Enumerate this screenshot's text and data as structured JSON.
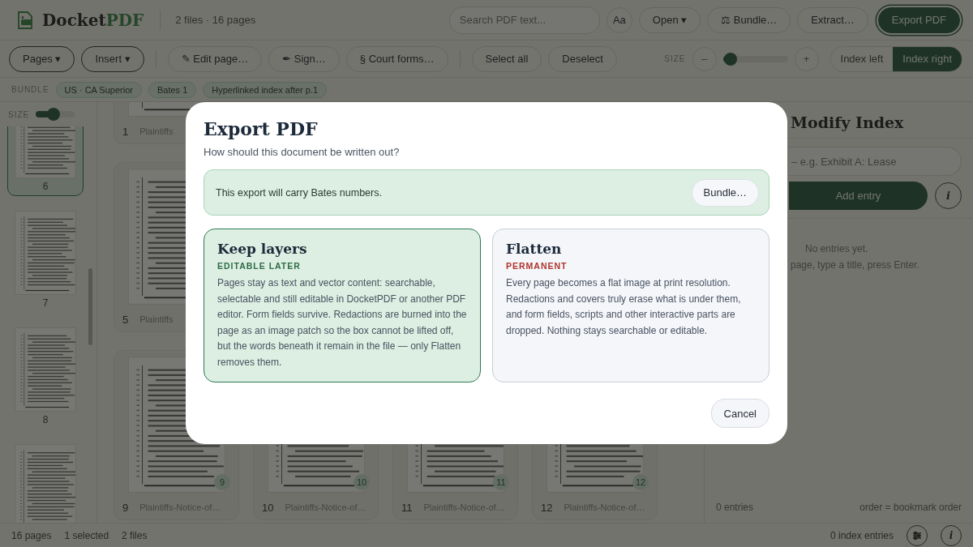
{
  "header": {
    "brand": [
      "Docket",
      "PDF"
    ],
    "summary": "2 files · 16 pages",
    "search": {
      "placeholder": "Search PDF text..."
    },
    "buttons": [
      {
        "label": "Aa",
        "kind": "round"
      },
      {
        "label": "Open ▾",
        "kind": "pill"
      },
      {
        "label": "⚖ Bundle…",
        "kind": "pill"
      },
      {
        "label": "Extract…",
        "kind": "pill"
      },
      {
        "label": "Export PDF",
        "kind": "primary"
      }
    ]
  },
  "toolbar": {
    "groups": [
      [
        {
          "label": "Pages ▾",
          "kind": "menu"
        },
        {
          "label": "Insert ▾",
          "kind": "menu"
        }
      ],
      [
        {
          "label": "✎ Edit page…",
          "kind": "pill"
        },
        {
          "label": "✒ Sign…",
          "kind": "pill"
        },
        {
          "label": "§ Court forms…",
          "kind": "pill"
        }
      ],
      [
        {
          "label": "Select all",
          "kind": "pill"
        },
        {
          "label": "Deselect",
          "kind": "pill"
        }
      ]
    ],
    "size": {
      "label": "SIZE",
      "minus": "–",
      "plus": "+",
      "level": 0.12
    },
    "layout_toggle": [
      {
        "label": "Index left",
        "selected": false
      },
      {
        "label": "Index right",
        "selected": true
      }
    ]
  },
  "bundle": {
    "label": "BUNDLE",
    "chips": [
      "US · CA Superior",
      "Bates 1",
      "Hyperlinked index after p.1"
    ]
  },
  "sidebar": {
    "size_label": "SIZE",
    "level": 0.45,
    "thumbnails": [
      {
        "label": "6",
        "selected": true
      },
      {
        "label": "7",
        "selected": false
      },
      {
        "label": "8",
        "selected": false
      },
      {
        "selected": false
      }
    ]
  },
  "pages": {
    "rows": [
      {
        "cards": [
          {
            "number": "1",
            "file": "Plaintiffs"
          }
        ]
      },
      {
        "cards": [
          {
            "number": "5",
            "file": "Plaintiffs"
          }
        ]
      },
      {
        "cards": [
          {
            "number": "9",
            "badge": "9",
            "file": "Plaintiffs-Notice-of…"
          },
          {
            "number": "10",
            "badge": "10",
            "file": "Plaintiffs-Notice-of…"
          },
          {
            "number": "11",
            "badge": "11",
            "file": "Plaintiffs-Notice-of…"
          },
          {
            "number": "12",
            "badge": "12",
            "file": "Plaintiffs-Notice-of…"
          }
        ]
      }
    ]
  },
  "index_panel": {
    "title": "Modify Index",
    "placeholder": "– e.g. Exhibit A: Lease",
    "add_button": "Add entry",
    "info_button": "i",
    "empty": [
      "No entries yet.",
      "page, type a title, press Enter."
    ],
    "count": "0 entries",
    "order": "order = bookmark order"
  },
  "status_bar": {
    "items": [
      "16 pages",
      "1 selected",
      "2 files"
    ],
    "index_count": "0 index entries",
    "info_button": "i"
  },
  "dialog": {
    "title": "Export PDF",
    "subtitle": "How should this document be written out?",
    "notice": {
      "text": "This export will carry Bates numbers.",
      "button": "Bundle…"
    },
    "options": [
      {
        "title": "Keep layers",
        "tag": "EDITABLE LATER",
        "color": "#2e6b47",
        "selected": true,
        "description": "Pages stay as text and vector content: searchable, selectable and still editable in DocketPDF or another PDF editor. Form fields survive. Redactions are burned into the page as an image patch so the box cannot be lifted off, but the words beneath it remain in the file — only Flatten removes them."
      },
      {
        "title": "Flatten",
        "tag": "PERMANENT",
        "color": "#b0322a",
        "selected": false,
        "description": "Every page becomes a flat image at print resolution. Redactions and covers truly erase what is under them, and form fields, scripts and other interactive parts are dropped. Nothing stays searchable or editable."
      }
    ],
    "cancel": "Cancel"
  }
}
